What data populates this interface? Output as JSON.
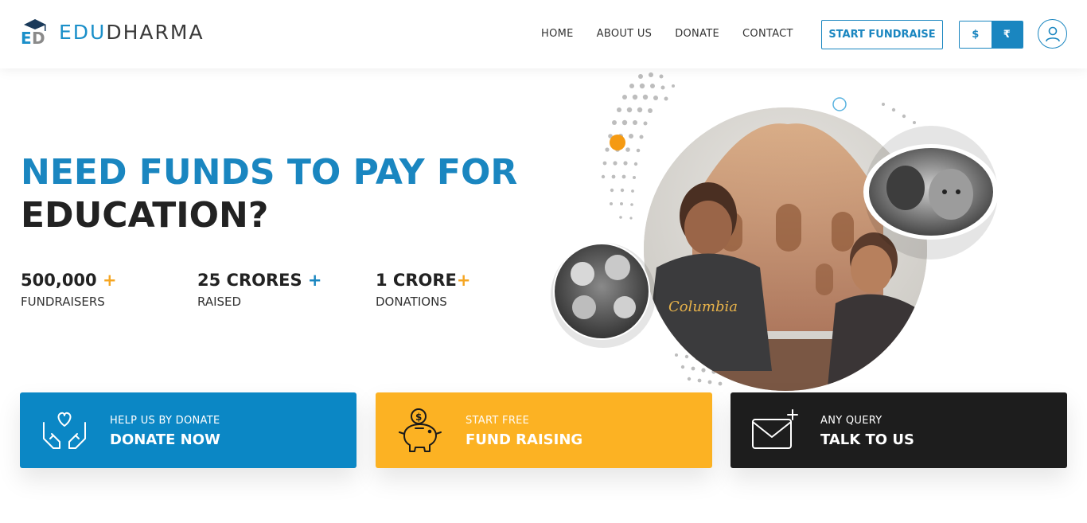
{
  "brand": {
    "part1": "EDU",
    "part2": "DHARMA",
    "logo_mark": "graduation-cap-ed-logo"
  },
  "nav": {
    "items": [
      {
        "label": "HOME"
      },
      {
        "label": "ABOUT US"
      },
      {
        "label": "DONATE"
      },
      {
        "label": "CONTACT"
      }
    ],
    "start_fundraise": "START FUNDRAISE",
    "currency": {
      "usd": "$",
      "inr": "₹",
      "selected": "inr"
    },
    "user_icon": "user-icon"
  },
  "hero": {
    "headline_line1": "NEED FUNDS TO PAY FOR",
    "headline_line2": "EDUCATION?",
    "stats": [
      {
        "value": "500,000",
        "plus": "+",
        "label": "FUNDRAISERS"
      },
      {
        "value": "25 CRORES",
        "plus": "+",
        "label": "RAISED"
      },
      {
        "value": "1 CRORE",
        "plus": "+",
        "label": "DONATIONS"
      }
    ]
  },
  "cards": [
    {
      "small": "HELP US BY DONATE",
      "big": "DONATE NOW",
      "icon": "hands-heart-icon"
    },
    {
      "small": "START FREE",
      "big": "FUND RAISING",
      "icon": "piggy-bank-icon"
    },
    {
      "small": "ANY QUERY",
      "big": "TALK TO US",
      "icon": "mail-plus-icon"
    }
  ],
  "colors": {
    "primary": "#1a86c0",
    "accent": "#f5a623",
    "card_blue": "#0b87c5",
    "card_yellow": "#fcb223",
    "card_black": "#1d1d1d"
  }
}
